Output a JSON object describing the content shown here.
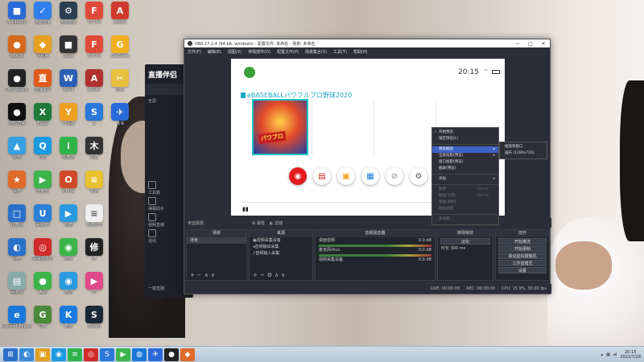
{
  "desktop_icons": [
    {
      "label": "A 144968",
      "glyph": "■",
      "color": "#2a6ad8",
      "col": 0,
      "row": 0
    },
    {
      "label": "电脑管家",
      "glyph": "✓",
      "color": "#2f80ed",
      "col": 1,
      "row": 0
    },
    {
      "label": "电脑管家",
      "glyph": "⚙",
      "color": "#2c3e50",
      "col": 2,
      "row": 0
    },
    {
      "label": "FX Pro",
      "glyph": "F",
      "color": "#e04a3a",
      "col": 3,
      "row": 0
    },
    {
      "label": "Adobe",
      "glyph": "A",
      "color": "#d03a2a",
      "col": 4,
      "row": 0
    },
    {
      "label": "NBA2K",
      "glyph": "●",
      "color": "#d46a1a",
      "col": 0,
      "row": 1
    },
    {
      "label": "小程序",
      "glyph": "◆",
      "color": "#e8a020",
      "col": 1,
      "row": 1
    },
    {
      "label": "Start",
      "glyph": "■",
      "color": "#333",
      "col": 2,
      "row": 1
    },
    {
      "label": "FX Pro",
      "glyph": "F",
      "color": "#e04a3a",
      "col": 3,
      "row": 1
    },
    {
      "label": "WeGame",
      "glyph": "G",
      "color": "#f0b020",
      "col": 4,
      "row": 1
    },
    {
      "label": "OBS Studio",
      "glyph": "●",
      "color": "#222",
      "col": 0,
      "row": 2
    },
    {
      "label": "直播工具",
      "glyph": "直",
      "color": "#e05a1a",
      "col": 1,
      "row": 2
    },
    {
      "label": "Word",
      "glyph": "W",
      "color": "#2b5fb4",
      "col": 2,
      "row": 2
    },
    {
      "label": "Adobe",
      "glyph": "A",
      "color": "#b03030",
      "col": 3,
      "row": 2
    },
    {
      "label": "剪映",
      "glyph": "✂",
      "color": "#e8c040",
      "col": 4,
      "row": 2
    },
    {
      "label": "OBS直播",
      "glyph": "●",
      "color": "#111",
      "col": 0,
      "row": 3
    },
    {
      "label": "Excel",
      "glyph": "X",
      "color": "#1f7a3a",
      "col": 1,
      "row": 3
    },
    {
      "label": "YY语音",
      "glyph": "Y",
      "color": "#f0a020",
      "col": 2,
      "row": 3
    },
    {
      "label": "S",
      "glyph": "S",
      "color": "#2a78d8",
      "col": 3,
      "row": 3
    },
    {
      "label": "飞书",
      "glyph": "✈",
      "color": "#2a6ad8",
      "col": 4,
      "row": 3
    },
    {
      "label": "雷电",
      "glyph": "▲",
      "color": "#37a0e0",
      "col": 0,
      "row": 4
    },
    {
      "label": "QQ",
      "glyph": "Q",
      "color": "#1a9ae0",
      "col": 1,
      "row": 4
    },
    {
      "label": "爱奇艺",
      "glyph": "i",
      "color": "#2fb44a",
      "col": 2,
      "row": 4
    },
    {
      "label": "文档",
      "glyph": "木",
      "color": "#333",
      "col": 3,
      "row": 4
    },
    {
      "label": "百度",
      "glyph": "★",
      "color": "#e06a2a",
      "col": 0,
      "row": 5
    },
    {
      "label": "应用宝",
      "glyph": "▶",
      "color": "#3cb44a",
      "col": 1,
      "row": 5
    },
    {
      "label": "Office",
      "glyph": "O",
      "color": "#d04a2a",
      "col": 2,
      "row": 5
    },
    {
      "label": "文档",
      "glyph": "≡",
      "color": "#e8c030",
      "col": 3,
      "row": 5
    },
    {
      "label": "计算机",
      "glyph": "□",
      "color": "#2a70c8",
      "col": 0,
      "row": 6
    },
    {
      "label": "网易UU",
      "glyph": "U",
      "color": "#2a80d8",
      "col": 1,
      "row": 6
    },
    {
      "label": "优酷",
      "glyph": "▶",
      "color": "#2a9ae0",
      "col": 2,
      "row": 6
    },
    {
      "label": "新建文本",
      "glyph": "≡",
      "color": "#eee",
      "col": 3,
      "row": 6
    },
    {
      "label": "网络",
      "glyph": "◐",
      "color": "#2a70c8",
      "col": 0,
      "row": 7
    },
    {
      "label": "网易云音乐",
      "glyph": "◎",
      "color": "#d02a2a",
      "col": 1,
      "row": 7
    },
    {
      "label": "游戏",
      "glyph": "◉",
      "color": "#3cb44a",
      "col": 2,
      "row": 7
    },
    {
      "label": "修",
      "glyph": "修",
      "color": "#222",
      "col": 3,
      "row": 7
    },
    {
      "label": "回收站",
      "glyph": "▤",
      "color": "#8aa",
      "col": 0,
      "row": 8
    },
    {
      "label": "腾讯",
      "glyph": "●",
      "color": "#3cb44a",
      "col": 1,
      "row": 8
    },
    {
      "label": "自助",
      "glyph": "◉",
      "color": "#2a9ae0",
      "col": 2,
      "row": 8
    },
    {
      "label": "PP",
      "glyph": "▶",
      "color": "#e04a8a",
      "col": 3,
      "row": 8
    },
    {
      "label": "Internet Explorer",
      "glyph": "e",
      "color": "#1a78d8",
      "col": 0,
      "row": 9
    },
    {
      "label": "GTA",
      "glyph": "G",
      "color": "#4a8a3a",
      "col": 1,
      "row": 9
    },
    {
      "label": "酷狗",
      "glyph": "K",
      "color": "#1a7ae0",
      "col": 2,
      "row": 9
    },
    {
      "label": "Steam",
      "glyph": "S",
      "color": "#1b2838",
      "col": 3,
      "row": 9
    }
  ],
  "bg_app": {
    "brand": "直播伴侣",
    "tab": "我的直播",
    "items": [
      "全屏",
      "工具箱",
      "弹幕助手",
      "视频直播",
      "连线",
      "一键直播"
    ]
  },
  "obs": {
    "title": "OBS 27.2.4 (64-bit, windows) - 配置文件: 未命名 - 场景: 未命名",
    "menu": [
      "文件(F)",
      "编辑(E)",
      "视图(V)",
      "停靠部件(D)",
      "配置文件(P)",
      "场景集合(S)",
      "工具(T)",
      "帮助(H)"
    ],
    "preview": {
      "time": "20:15",
      "game_title": "eBASEBALLパワフルプロ野球2020",
      "game_badge": "パワプロ"
    },
    "context_menu": [
      {
        "label": "开始预览",
        "state": "normal"
      },
      {
        "label": "锁定预览(L)",
        "state": "normal"
      },
      {
        "label": "预览缩放",
        "state": "selected",
        "submenu": true
      },
      {
        "label": "全屏投影(预览)",
        "state": "normal",
        "submenu": true
      },
      {
        "label": "窗口投影(预览)",
        "state": "normal"
      },
      {
        "label": "截屏(预览)",
        "state": "normal"
      },
      {
        "label": "添加",
        "state": "normal",
        "submenu": true
      },
      {
        "label": "复制",
        "state": "disabled",
        "shortcut": "Ctrl+C"
      },
      {
        "label": "粘贴(引用)",
        "state": "disabled",
        "shortcut": "Ctrl+V"
      },
      {
        "label": "粘贴(复制)",
        "state": "disabled"
      },
      {
        "label": "粘贴滤镜",
        "state": "disabled"
      },
      {
        "label": "多视图",
        "state": "disabled"
      }
    ],
    "submenu": [
      "缩放到窗口",
      "画布 (1280x720)"
    ],
    "source_bar": {
      "label": "未选择源",
      "filters": "属性",
      "filters2": "滤镜"
    },
    "scenes": {
      "header": "场景",
      "items": [
        "场景"
      ]
    },
    "sources": {
      "header": "来源",
      "items": [
        "视频采集设备",
        "音频输出采集",
        "音频输入采集"
      ]
    },
    "mixer": {
      "header": "音频混音器",
      "channels": [
        {
          "name": "桌面音频",
          "level": "0.0 dB"
        },
        {
          "name": "麦克风/Aux",
          "level": "0.0 dB"
        },
        {
          "name": "视频采集设备",
          "level": "0.0 dB"
        }
      ]
    },
    "transitions": {
      "header": "转场特效",
      "type": "淡化",
      "duration_label": "时长",
      "duration": "300 ms"
    },
    "controls": {
      "header": "控件",
      "buttons": [
        "开始推流",
        "开始录制",
        "启动虚拟摄像机",
        "工作室模式",
        "设置",
        "退出"
      ]
    },
    "status": {
      "live": "LIVE: 00:00:00",
      "rec": "REC: 00:00:00",
      "cpu": "CPU: 15.9%, 30.00 fps"
    }
  },
  "taskbar": {
    "clock_time": "20:15",
    "clock_date": "2022/7/28",
    "apps": [
      {
        "glyph": "⊞",
        "color": "#2a70c8"
      },
      {
        "glyph": "◐",
        "color": "#3a8ad8"
      },
      {
        "glyph": "▣",
        "color": "#e0a020"
      },
      {
        "glyph": "◉",
        "color": "#1a9ae0"
      },
      {
        "glyph": "≡",
        "color": "#2fb44a"
      },
      {
        "glyph": "◎",
        "color": "#d02a2a"
      },
      {
        "glyph": "S",
        "color": "#2a78d8"
      },
      {
        "glyph": "▶",
        "color": "#3cb44a"
      },
      {
        "glyph": "◍",
        "color": "#1a78d8"
      },
      {
        "glyph": "✈",
        "color": "#2a6ad8"
      },
      {
        "glyph": "●",
        "color": "#222"
      },
      {
        "glyph": "◆",
        "color": "#e06a2a"
      }
    ]
  }
}
